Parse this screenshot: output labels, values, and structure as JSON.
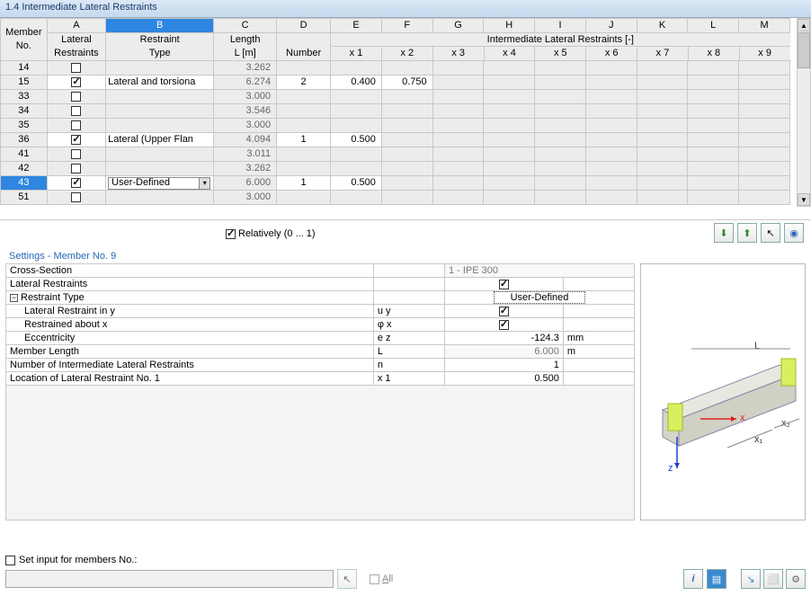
{
  "title": "1.4 Intermediate Lateral Restraints",
  "grid": {
    "headers": {
      "member_no": "Member\nNo.",
      "cols": [
        "A",
        "B",
        "C",
        "D",
        "E",
        "F",
        "G",
        "H",
        "I",
        "J",
        "K",
        "L",
        "M"
      ],
      "a": "Lateral\nRestraints",
      "b": "Restraint\nType",
      "c": "Length\nL [m]",
      "d": "Number",
      "group": "Intermediate Lateral Restraints [-]",
      "x": [
        "x 1",
        "x 2",
        "x 3",
        "x 4",
        "x 5",
        "x 6",
        "x 7",
        "x 8",
        "x 9"
      ]
    },
    "rows": [
      {
        "no": "14",
        "lr": false,
        "type": "",
        "len": "3.262",
        "num": "",
        "xs": [
          "",
          "",
          "",
          "",
          "",
          "",
          "",
          "",
          ""
        ]
      },
      {
        "no": "15",
        "lr": true,
        "type": "Lateral and torsiona",
        "len": "6.274",
        "num": "2",
        "xs": [
          "0.400",
          "0.750",
          "",
          "",
          "",
          "",
          "",
          "",
          ""
        ]
      },
      {
        "no": "33",
        "lr": false,
        "type": "",
        "len": "3.000",
        "num": "",
        "xs": [
          "",
          "",
          "",
          "",
          "",
          "",
          "",
          "",
          ""
        ]
      },
      {
        "no": "34",
        "lr": false,
        "type": "",
        "len": "3.546",
        "num": "",
        "xs": [
          "",
          "",
          "",
          "",
          "",
          "",
          "",
          "",
          ""
        ]
      },
      {
        "no": "35",
        "lr": false,
        "type": "",
        "len": "3.000",
        "num": "",
        "xs": [
          "",
          "",
          "",
          "",
          "",
          "",
          "",
          "",
          ""
        ]
      },
      {
        "no": "36",
        "lr": true,
        "type": "Lateral (Upper Flan",
        "len": "4.094",
        "num": "1",
        "xs": [
          "0.500",
          "",
          "",
          "",
          "",
          "",
          "",
          "",
          ""
        ]
      },
      {
        "no": "41",
        "lr": false,
        "type": "",
        "len": "3.011",
        "num": "",
        "xs": [
          "",
          "",
          "",
          "",
          "",
          "",
          "",
          "",
          ""
        ]
      },
      {
        "no": "42",
        "lr": false,
        "type": "",
        "len": "3.262",
        "num": "",
        "xs": [
          "",
          "",
          "",
          "",
          "",
          "",
          "",
          "",
          ""
        ]
      },
      {
        "no": "43",
        "lr": true,
        "type": "User-Defined",
        "len": "6.000",
        "num": "1",
        "xs": [
          "0.500",
          "",
          "",
          "",
          "",
          "",
          "",
          "",
          ""
        ],
        "selected": true,
        "dropdown": true
      },
      {
        "no": "51",
        "lr": false,
        "type": "",
        "len": "3.000",
        "num": "",
        "xs": [
          "",
          "",
          "",
          "",
          "",
          "",
          "",
          "",
          ""
        ]
      }
    ]
  },
  "relatively": {
    "checked": true,
    "label": "Relatively (0 ... 1)"
  },
  "settings": {
    "title": "Settings - Member No. 9",
    "rows": {
      "cross_section": {
        "label": "Cross-Section",
        "value": "1 - IPE 300"
      },
      "lateral_restraints": {
        "label": "Lateral Restraints",
        "checked": true
      },
      "restraint_type": {
        "label": "Restraint Type",
        "value": "User-Defined"
      },
      "lat_y": {
        "label": "Lateral Restraint in y",
        "sym": "u y",
        "checked": true
      },
      "rest_x": {
        "label": "Restrained about x",
        "sym": "φ x",
        "checked": true
      },
      "ecc": {
        "label": "Eccentricity",
        "sym": "e z",
        "value": "-124.3",
        "unit": "mm"
      },
      "mlen": {
        "label": "Member Length",
        "sym": "L",
        "value": "6.000",
        "unit": "m"
      },
      "nrest": {
        "label": "Number of Intermediate Lateral Restraints",
        "sym": "n",
        "value": "1"
      },
      "loc1": {
        "label": "Location of Lateral Restraint No. 1",
        "sym": "x 1",
        "value": "0.500"
      }
    }
  },
  "bottom": {
    "set_input_label": "Set input for members No.:",
    "all_label": "All"
  },
  "icons": {
    "excel_out": "📤",
    "excel_in": "📥",
    "pick": "⬈",
    "eye": "👁",
    "info": "ℹ",
    "diag": "▦",
    "b1": "↘",
    "b2": "⬜",
    "b3": "⚙"
  },
  "diagram_labels": {
    "L": "L",
    "x": "x",
    "x1": "x₁",
    "x2": "x₂",
    "z": "z"
  }
}
